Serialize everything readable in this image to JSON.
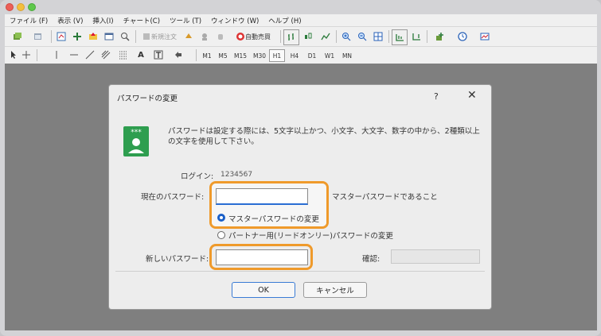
{
  "menubar": {
    "items": [
      "ファイル (F)",
      "表示 (V)",
      "挿入(I)",
      "チャート(C)",
      "ツール (T)",
      "ウィンドウ (W)",
      "ヘルプ (H)"
    ]
  },
  "toolbar": {
    "new_order": "新規注文",
    "auto_trade": "自動売買",
    "timeframes": [
      "M1",
      "M5",
      "M15",
      "M30",
      "H1",
      "H4",
      "D1",
      "W1",
      "MN"
    ],
    "active_timeframe": "H1",
    "text_tool": "A"
  },
  "dialog": {
    "title": "パスワードの変更",
    "help": "?",
    "close": "✕",
    "message": "パスワードは設定する際には、5文字以上かつ、小文字、大文字、数字の中から、2種類以上の文字を使用して下さい。",
    "login_label": "ログイン:",
    "login_value": "1234567",
    "current_password_label": "現在のパスワード:",
    "master_password_note": "マスターパスワードであること",
    "radio_master": "マスターパスワードの変更",
    "radio_investor": "パートナー用(リードオンリー)パスワードの変更",
    "new_password_label": "新しいパスワード:",
    "confirm_label": "確認:",
    "ok": "OK",
    "cancel": "キャンセル"
  },
  "colors": {
    "highlight": "#ef9a2b",
    "accent": "#1a5fc8",
    "icon_green": "#2e9e4f"
  }
}
